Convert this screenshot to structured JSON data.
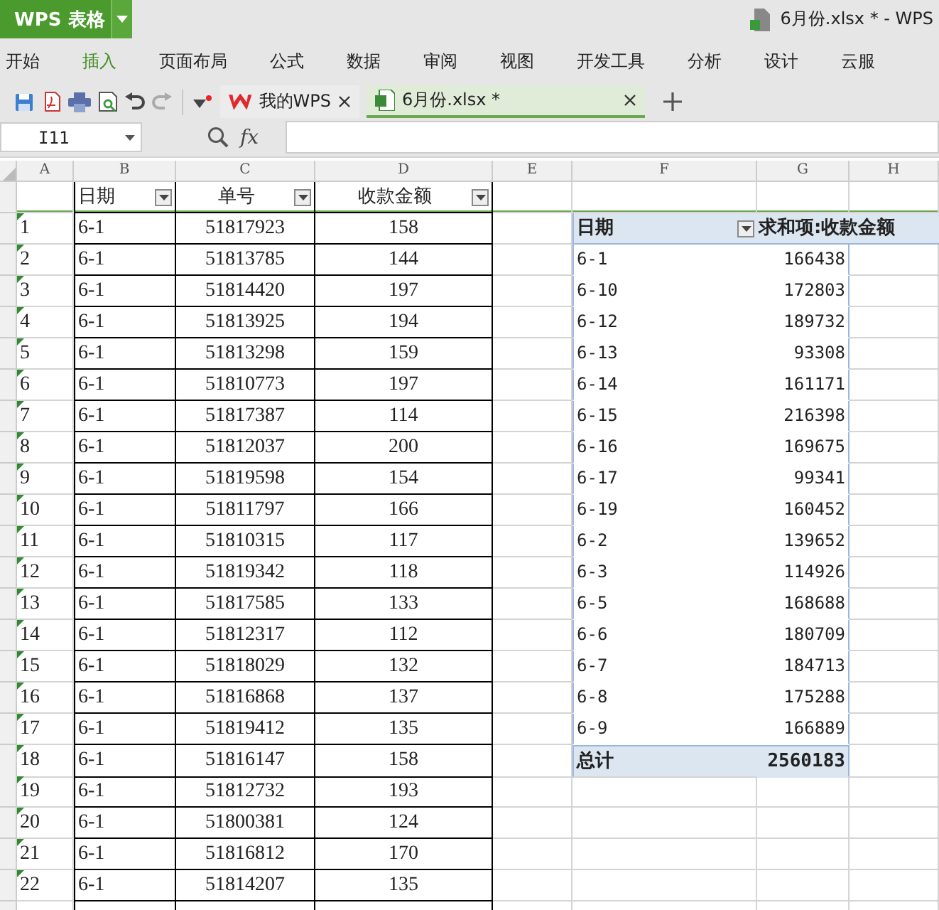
{
  "app_button": {
    "label": "WPS 表格"
  },
  "window": {
    "title": "6月份.xlsx * - WPS"
  },
  "menu": [
    {
      "label": "开始",
      "selected": false
    },
    {
      "label": "插入",
      "selected": true
    },
    {
      "label": "页面布局",
      "selected": false
    },
    {
      "label": "公式",
      "selected": false
    },
    {
      "label": "数据",
      "selected": false
    },
    {
      "label": "审阅",
      "selected": false
    },
    {
      "label": "视图",
      "selected": false
    },
    {
      "label": "开发工具",
      "selected": false
    },
    {
      "label": "分析",
      "selected": false
    },
    {
      "label": "设计",
      "selected": false
    },
    {
      "label": "云服",
      "selected": false
    }
  ],
  "tabs": [
    {
      "label": "我的WPS",
      "selected": false
    },
    {
      "label": "6月份.xlsx *",
      "selected": true
    }
  ],
  "formula_bar": {
    "name_box": "I11",
    "fx": "fx"
  },
  "sheet": {
    "columns": [
      "A",
      "B",
      "C",
      "D",
      "E",
      "F",
      "G",
      "H"
    ],
    "header": [
      "日期",
      "单号",
      "收款金额"
    ],
    "rows": [
      [
        "1",
        "6-1",
        "51817923",
        "158"
      ],
      [
        "2",
        "6-1",
        "51813785",
        "144"
      ],
      [
        "3",
        "6-1",
        "51814420",
        "197"
      ],
      [
        "4",
        "6-1",
        "51813925",
        "194"
      ],
      [
        "5",
        "6-1",
        "51813298",
        "159"
      ],
      [
        "6",
        "6-1",
        "51810773",
        "197"
      ],
      [
        "7",
        "6-1",
        "51817387",
        "114"
      ],
      [
        "8",
        "6-1",
        "51812037",
        "200"
      ],
      [
        "9",
        "6-1",
        "51819598",
        "154"
      ],
      [
        "10",
        "6-1",
        "51811797",
        "166"
      ],
      [
        "11",
        "6-1",
        "51810315",
        "117"
      ],
      [
        "12",
        "6-1",
        "51819342",
        "118"
      ],
      [
        "13",
        "6-1",
        "51817585",
        "133"
      ],
      [
        "14",
        "6-1",
        "51812317",
        "112"
      ],
      [
        "15",
        "6-1",
        "51818029",
        "132"
      ],
      [
        "16",
        "6-1",
        "51816868",
        "137"
      ],
      [
        "17",
        "6-1",
        "51819412",
        "135"
      ],
      [
        "18",
        "6-1",
        "51816147",
        "158"
      ],
      [
        "19",
        "6-1",
        "51812732",
        "193"
      ],
      [
        "20",
        "6-1",
        "51800381",
        "124"
      ],
      [
        "21",
        "6-1",
        "51816812",
        "170"
      ],
      [
        "22",
        "6-1",
        "51814207",
        "135"
      ]
    ]
  },
  "pivot": {
    "headers": [
      "日期",
      "求和项:收款金额"
    ],
    "rows": [
      [
        "6-1",
        "166438"
      ],
      [
        "6-10",
        "172803"
      ],
      [
        "6-12",
        "189732"
      ],
      [
        "6-13",
        "93308"
      ],
      [
        "6-14",
        "161171"
      ],
      [
        "6-15",
        "216398"
      ],
      [
        "6-16",
        "169675"
      ],
      [
        "6-17",
        "99341"
      ],
      [
        "6-19",
        "160452"
      ],
      [
        "6-2",
        "139652"
      ],
      [
        "6-3",
        "114926"
      ],
      [
        "6-5",
        "168688"
      ],
      [
        "6-6",
        "180709"
      ],
      [
        "6-7",
        "184713"
      ],
      [
        "6-8",
        "175288"
      ],
      [
        "6-9",
        "166889"
      ]
    ],
    "total": [
      "总计",
      "2560183"
    ]
  }
}
